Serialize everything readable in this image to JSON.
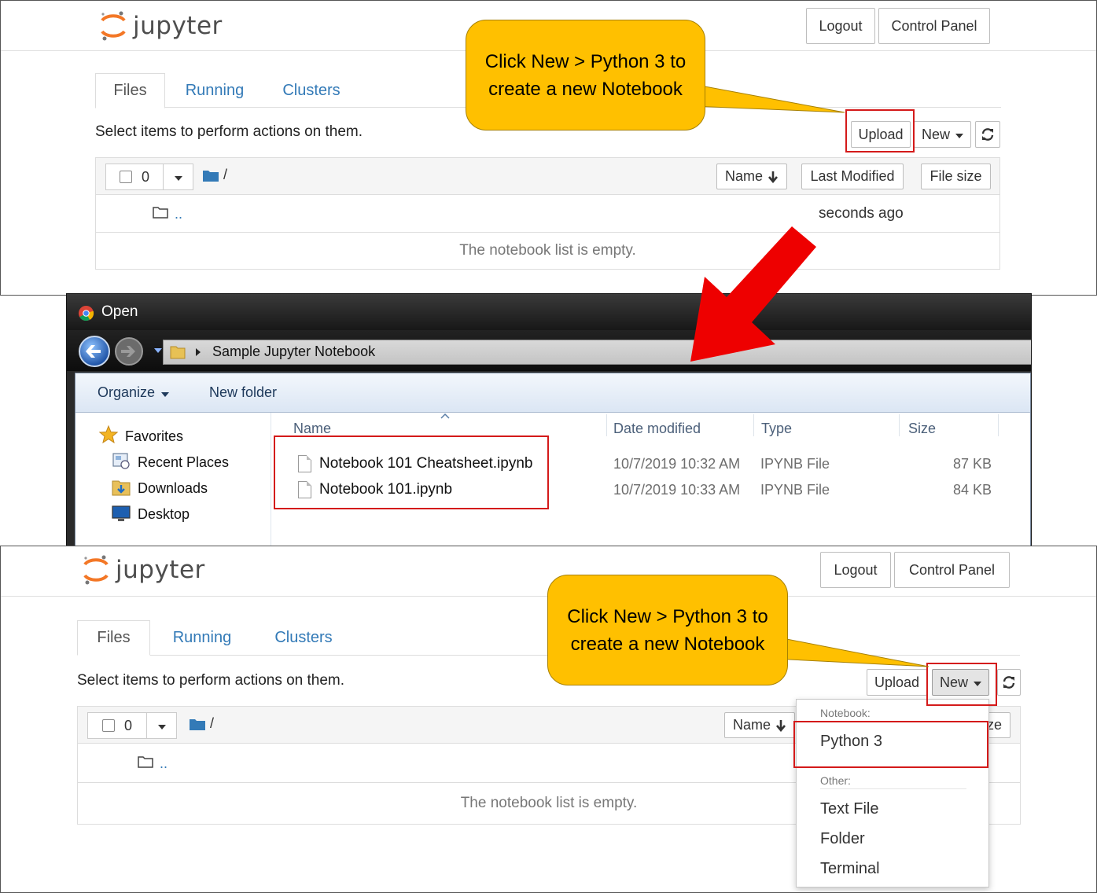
{
  "top_panel": {
    "logo_text": "jupyter",
    "logout": "Logout",
    "control_panel": "Control Panel",
    "tabs": [
      {
        "label": "Files"
      },
      {
        "label": "Running"
      },
      {
        "label": "Clusters"
      }
    ],
    "select_text": "Select items to perform actions on them.",
    "upload": "Upload",
    "new": "New",
    "selected_count": "0",
    "path_slash": "/",
    "columns": {
      "name": "Name",
      "last_modified": "Last Modified",
      "file_size": "File size"
    },
    "parent_dir": "..",
    "parent_modified": "seconds ago",
    "empty_text": "The notebook list is empty.",
    "callout": "Click New > Python 3 to create a new Notebook"
  },
  "open_dialog": {
    "title": "Open",
    "address": "Sample Jupyter Notebook",
    "toolbar": {
      "organize": "Organize",
      "new_folder": "New folder"
    },
    "sidebar": [
      {
        "label": "Favorites",
        "icon": "star-icon"
      },
      {
        "label": "Recent Places",
        "icon": "recent-places-icon"
      },
      {
        "label": "Downloads",
        "icon": "downloads-folder-icon"
      },
      {
        "label": "Desktop",
        "icon": "desktop-icon"
      }
    ],
    "columns": {
      "name": "Name",
      "date": "Date modified",
      "type": "Type",
      "size": "Size"
    },
    "files": [
      {
        "name": "Notebook 101 Cheatsheet.ipynb",
        "date": "10/7/2019 10:32 AM",
        "type": "IPYNB File",
        "size": "87 KB"
      },
      {
        "name": "Notebook 101.ipynb",
        "date": "10/7/2019 10:33 AM",
        "type": "IPYNB File",
        "size": "84 KB"
      }
    ]
  },
  "bottom_panel": {
    "logo_text": "jupyter",
    "logout": "Logout",
    "control_panel": "Control Panel",
    "tabs": [
      {
        "label": "Files"
      },
      {
        "label": "Running"
      },
      {
        "label": "Clusters"
      }
    ],
    "select_text": "Select items to perform actions on them.",
    "upload": "Upload",
    "new": "New",
    "selected_count": "0",
    "path_slash": "/",
    "columns": {
      "name": "Name",
      "file_size_partial": "ze"
    },
    "parent_dir": "..",
    "empty_text": "The notebook list is empty.",
    "callout": "Click New > Python 3 to create a new Notebook",
    "dropdown": {
      "notebook_header": "Notebook:",
      "python3": "Python 3",
      "other_header": "Other:",
      "text_file": "Text File",
      "folder": "Folder",
      "terminal": "Terminal"
    }
  },
  "colors": {
    "callout": "#ffc000",
    "highlight": "#d41a1a",
    "arrow": "#ee0000",
    "link": "#337ab7",
    "jupyter_orange": "#f37726"
  }
}
